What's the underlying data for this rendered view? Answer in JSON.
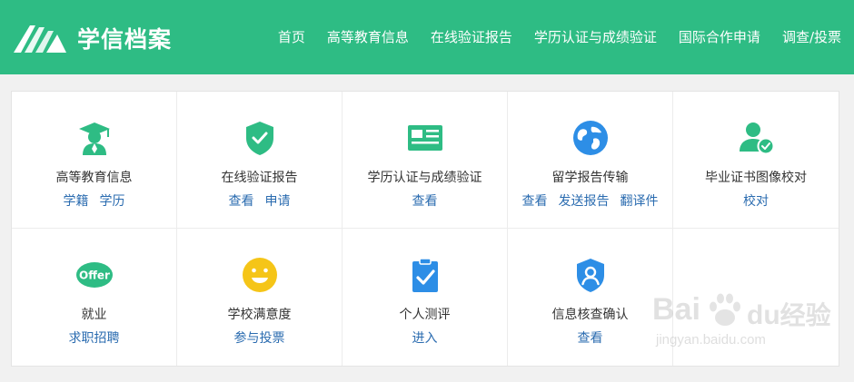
{
  "header": {
    "logo_text": "学信档案",
    "nav": [
      "首页",
      "高等教育信息",
      "在线验证报告",
      "学历认证与成绩验证",
      "国际合作申请",
      "调查/投票"
    ]
  },
  "grid": {
    "row1": [
      {
        "icon": "graduate-icon",
        "title": "高等教育信息",
        "links": [
          "学籍",
          "学历"
        ]
      },
      {
        "icon": "shield-check-icon",
        "title": "在线验证报告",
        "links": [
          "查看",
          "申请"
        ]
      },
      {
        "icon": "id-card-icon",
        "title": "学历认证与成绩验证",
        "links": [
          "查看"
        ]
      },
      {
        "icon": "globe-icon",
        "title": "留学报告传输",
        "links": [
          "查看",
          "发送报告",
          "翻译件"
        ]
      },
      {
        "icon": "user-check-icon",
        "title": "毕业证书图像校对",
        "links": [
          "校对"
        ]
      }
    ],
    "row2": [
      {
        "icon": "offer-icon",
        "icon_text": "Offer",
        "title": "就业",
        "links": [
          "求职招聘"
        ]
      },
      {
        "icon": "smiley-icon",
        "title": "学校满意度",
        "links": [
          "参与投票"
        ]
      },
      {
        "icon": "clipboard-check-icon",
        "title": "个人测评",
        "links": [
          "进入"
        ]
      },
      {
        "icon": "shield-user-icon",
        "title": "信息核查确认",
        "links": [
          "查看"
        ]
      }
    ]
  },
  "watermark": {
    "brand": "Bai",
    "brand2": "du",
    "cn": "经验",
    "url": "jingyan.baidu.com"
  },
  "colors": {
    "brand_green": "#2ebc84",
    "link_blue": "#2b6cb0",
    "icon_blue": "#2d8ee6",
    "icon_yellow": "#f5c518"
  }
}
